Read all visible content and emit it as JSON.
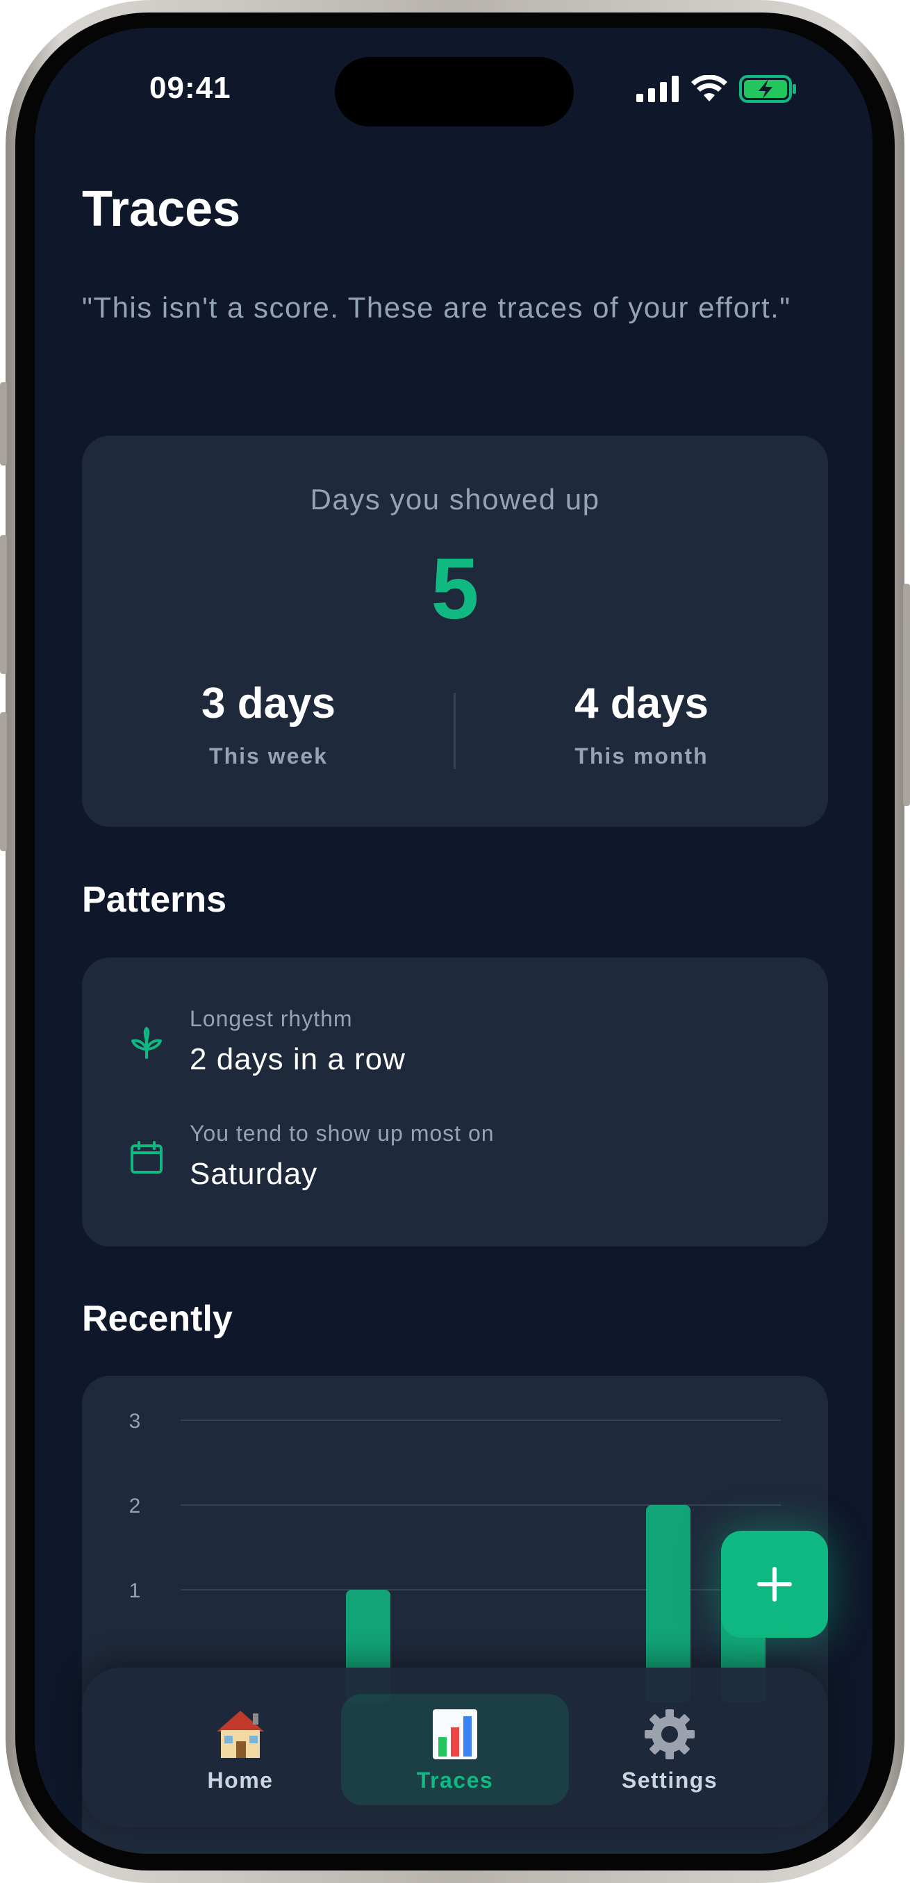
{
  "status_bar": {
    "time": "09:41"
  },
  "header": {
    "title": "Traces",
    "subtitle": "\"This isn't a score. These are traces of your effort.\""
  },
  "summary": {
    "label": "Days you showed up",
    "total": "5",
    "week_value": "3 days",
    "week_label": "This week",
    "month_value": "4 days",
    "month_label": "This month"
  },
  "patterns": {
    "title": "Patterns",
    "items": [
      {
        "icon": "sprout-icon",
        "label": "Longest rhythm",
        "value": "2 days in a row"
      },
      {
        "icon": "calendar-icon",
        "label": "You tend to show up most on",
        "value": "Saturday"
      }
    ]
  },
  "recently": {
    "title": "Recently"
  },
  "chart_data": {
    "type": "bar",
    "y_ticks": [
      "1",
      "2",
      "3"
    ],
    "ylim": [
      0,
      3
    ],
    "values": [
      0,
      0,
      1,
      0,
      0,
      0,
      2,
      1
    ],
    "grid": true
  },
  "tabbar": {
    "items": [
      {
        "label": "Home",
        "icon": "house-icon",
        "active": false
      },
      {
        "label": "Traces",
        "icon": "bar-chart-icon",
        "active": true
      },
      {
        "label": "Settings",
        "icon": "gear-icon",
        "active": false
      }
    ]
  },
  "colors": {
    "accent": "#10b981",
    "background": "#0f172a",
    "card": "#1e293b",
    "muted": "#94a3b8"
  }
}
